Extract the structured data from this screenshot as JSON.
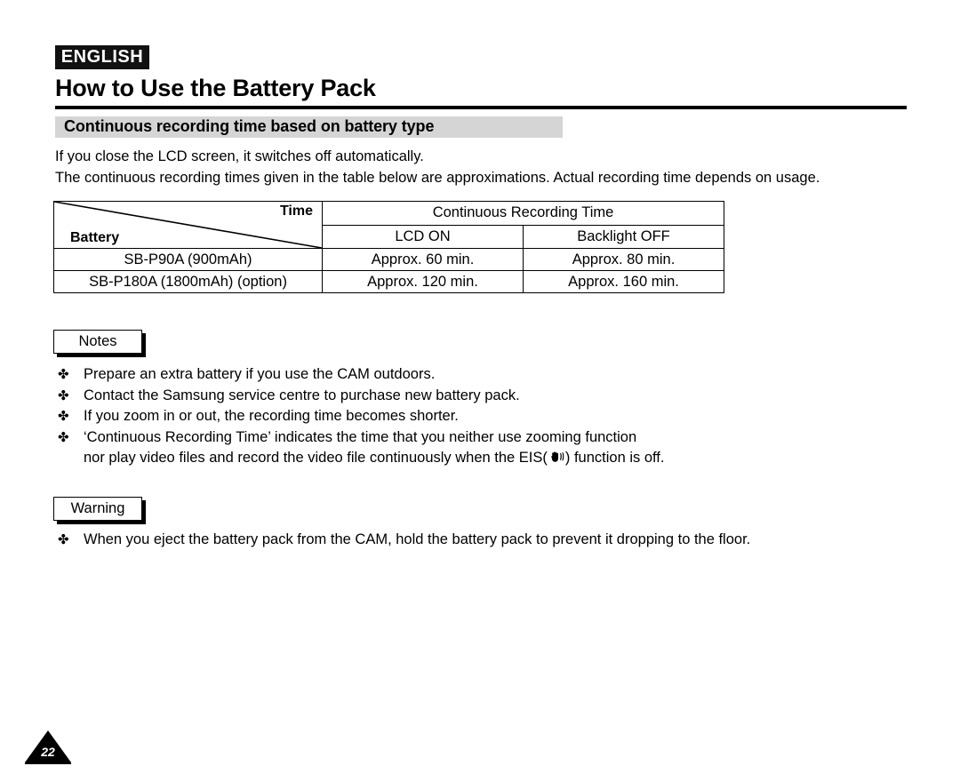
{
  "header": {
    "language_badge": "ENGLISH",
    "title": "How to Use the Battery Pack",
    "subtitle": "Continuous recording time based on battery type"
  },
  "intro": {
    "line1": "If you close the LCD screen, it switches off automatically.",
    "line2": "The continuous recording times given in the table below are approximations. Actual recording time depends on usage."
  },
  "table": {
    "corner_top_label": "Time",
    "corner_bottom_label": "Battery",
    "group_header": "Continuous Recording Time",
    "sub_headers": [
      "LCD ON",
      "Backlight OFF"
    ],
    "rows": [
      {
        "battery": "SB-P90A (900mAh)",
        "lcd_on": "Approx. 60 min.",
        "backlight_off": "Approx. 80 min."
      },
      {
        "battery": "SB-P180A (1800mAh) (option)",
        "lcd_on": "Approx. 120 min.",
        "backlight_off": "Approx. 160 min."
      }
    ]
  },
  "notes": {
    "label": "Notes",
    "bullet_glyph": "✤",
    "items": [
      {
        "text": "Prepare an extra battery if you use the CAM outdoors."
      },
      {
        "text": "Contact the Samsung service centre to purchase new battery pack."
      },
      {
        "text": "If you zoom in or out, the recording time becomes shorter."
      },
      {
        "text": "‘Continuous Recording Time’ indicates the time that you neither use zooming function",
        "continuation_before_icon": "nor play video files and record the video file continuously when the EIS(",
        "icon_name": "eis-anti-shake-icon",
        "continuation_after_icon": ") function is off."
      }
    ]
  },
  "warning": {
    "label": "Warning",
    "bullet_glyph": "✤",
    "items": [
      {
        "text": "When you eject the battery pack from the CAM, hold the battery pack to prevent it dropping to the floor."
      }
    ]
  },
  "footer": {
    "page_number": "22"
  },
  "colors": {
    "text": "#000000",
    "badge_background": "#111111",
    "subtitle_bar": "#d5d5d5",
    "page_background": "#ffffff"
  }
}
